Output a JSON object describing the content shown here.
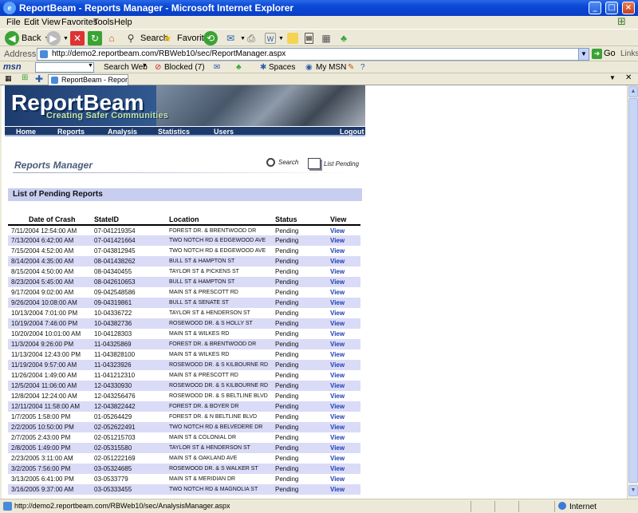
{
  "window": {
    "title": "ReportBeam - Reports Manager - Microsoft Internet Explorer",
    "min": "_",
    "max": "□",
    "close": "×"
  },
  "menu": [
    "File",
    "Edit",
    "View",
    "Favorites",
    "Tools",
    "Help"
  ],
  "toolbar": {
    "back": "Back",
    "search": "Search",
    "favorites": "Favorites"
  },
  "address": {
    "label": "Address",
    "url": "http://demo2.reportbeam.com/RBWeb10/sec/ReportManager.aspx",
    "go": "Go",
    "links": "Links"
  },
  "msn": {
    "logo": "msn",
    "search_web": "Search Web",
    "blocked": "Blocked (7)",
    "spaces": "Spaces",
    "my_msn": "My MSN"
  },
  "tab": {
    "label": "ReportBeam - Reports..."
  },
  "banner": {
    "brand": "ReportBeam",
    "tagline": "Creating Safer Communities"
  },
  "nav": {
    "home": "Home",
    "reports": "Reports",
    "analysis": "Analysis",
    "statistics": "Statistics",
    "users": "Users",
    "logout": "Logout"
  },
  "page": {
    "title": "Reports Manager",
    "search_label": "Search",
    "list_pending_label": "List Pending",
    "section": "List of Pending Reports"
  },
  "table": {
    "headers": [
      "Date of Crash",
      "StateID",
      "Location",
      "Status",
      "View"
    ],
    "rows": [
      [
        "7/11/2004 12:54:00 AM",
        "07-041219354",
        "FOREST DR. & BRENTWOOD DR",
        "Pending",
        "View"
      ],
      [
        "7/13/2004 6:42:00 AM",
        "07-041421664",
        "TWO NOTCH RD & EDGEWOOD AVE",
        "Pending",
        "View"
      ],
      [
        "7/15/2004 4:52:00 AM",
        "07-043812945",
        "TWO NOTCH RD & EDGEWOOD AVE",
        "Pending",
        "View"
      ],
      [
        "8/14/2004 4:35:00 AM",
        "08-041438262",
        "BULL ST & HAMPTON ST",
        "Pending",
        "View"
      ],
      [
        "8/15/2004 4:50:00 AM",
        "08-04340455",
        "TAYLOR ST & PICKENS ST",
        "Pending",
        "View"
      ],
      [
        "8/23/2004 5:45:00 AM",
        "08-042610653",
        "BULL ST & HAMPTON ST",
        "Pending",
        "View"
      ],
      [
        "9/17/2004 9:02:00 AM",
        "09-042548586",
        "MAIN ST & PRESCOTT RD",
        "Pending",
        "View"
      ],
      [
        "9/26/2004 10:08:00 AM",
        "09-04319861",
        "BULL ST & SENATE ST",
        "Pending",
        "View"
      ],
      [
        "10/13/2004 7:01:00 PM",
        "10-04336722",
        "TAYLOR ST & HENDERSON ST",
        "Pending",
        "View"
      ],
      [
        "10/19/2004 7:46:00 PM",
        "10-04382736",
        "ROSEWOOD DR. & S HOLLY ST",
        "Pending",
        "View"
      ],
      [
        "10/20/2004 10:01:00 AM",
        "10-04128303",
        "MAIN ST & WILKES RD",
        "Pending",
        "View"
      ],
      [
        "11/3/2004 9:26:00 PM",
        "11-04325869",
        "FOREST DR. & BRENTWOOD DR",
        "Pending",
        "View"
      ],
      [
        "11/13/2004 12:43:00 PM",
        "11-043828100",
        "MAIN ST & WILKES RD",
        "Pending",
        "View"
      ],
      [
        "11/19/2004 9:57:00 AM",
        "11-04323926",
        "ROSEWOOD DR. & S KILBOURNE RD",
        "Pending",
        "View"
      ],
      [
        "11/26/2004 1:49:00 AM",
        "11-041212310",
        "MAIN ST & PRESCOTT RD",
        "Pending",
        "View"
      ],
      [
        "12/5/2004 11:06:00 AM",
        "12-04330930",
        "ROSEWOOD DR. & S KILBOURNE RD",
        "Pending",
        "View"
      ],
      [
        "12/8/2004 12:24:00 AM",
        "12-043256476",
        "ROSEWOOD DR. & S BELTLINE BLVD",
        "Pending",
        "View"
      ],
      [
        "12/11/2004 11:58:00 AM",
        "12-043822442",
        "FOREST DR. & BOYER DR",
        "Pending",
        "View"
      ],
      [
        "1/7/2005 1:58:00 PM",
        "01-05264429",
        "FOREST DR. & N BELTLINE BLVD",
        "Pending",
        "View"
      ],
      [
        "2/2/2005 10:50:00 PM",
        "02-052622491",
        "TWO NOTCH RD & BELVEDERE DR",
        "Pending",
        "View"
      ],
      [
        "2/7/2005 2:43:00 PM",
        "02-051215703",
        "MAIN ST & COLONIAL DR",
        "Pending",
        "View"
      ],
      [
        "2/8/2005 1:49:00 PM",
        "02-05315580",
        "TAYLOR ST & HENDERSON ST",
        "Pending",
        "View"
      ],
      [
        "2/23/2005 3:11:00 AM",
        "02-051222169",
        "MAIN ST & OAKLAND AVE",
        "Pending",
        "View"
      ],
      [
        "3/2/2005 7:56:00 PM",
        "03-05324685",
        "ROSEWOOD DR. & S WALKER ST",
        "Pending",
        "View"
      ],
      [
        "3/13/2005 6:41:00 PM",
        "03-0533779",
        "MAIN ST & MERIDIAN DR",
        "Pending",
        "View"
      ],
      [
        "3/16/2005 9:37:00 AM",
        "03-05333455",
        "TWO NOTCH RD & MAGNOLIA ST",
        "Pending",
        "View"
      ]
    ]
  },
  "status": {
    "url": "http://demo2.reportbeam.com/RBWeb10/sec/AnalysisManager.aspx",
    "zone": "Internet"
  }
}
